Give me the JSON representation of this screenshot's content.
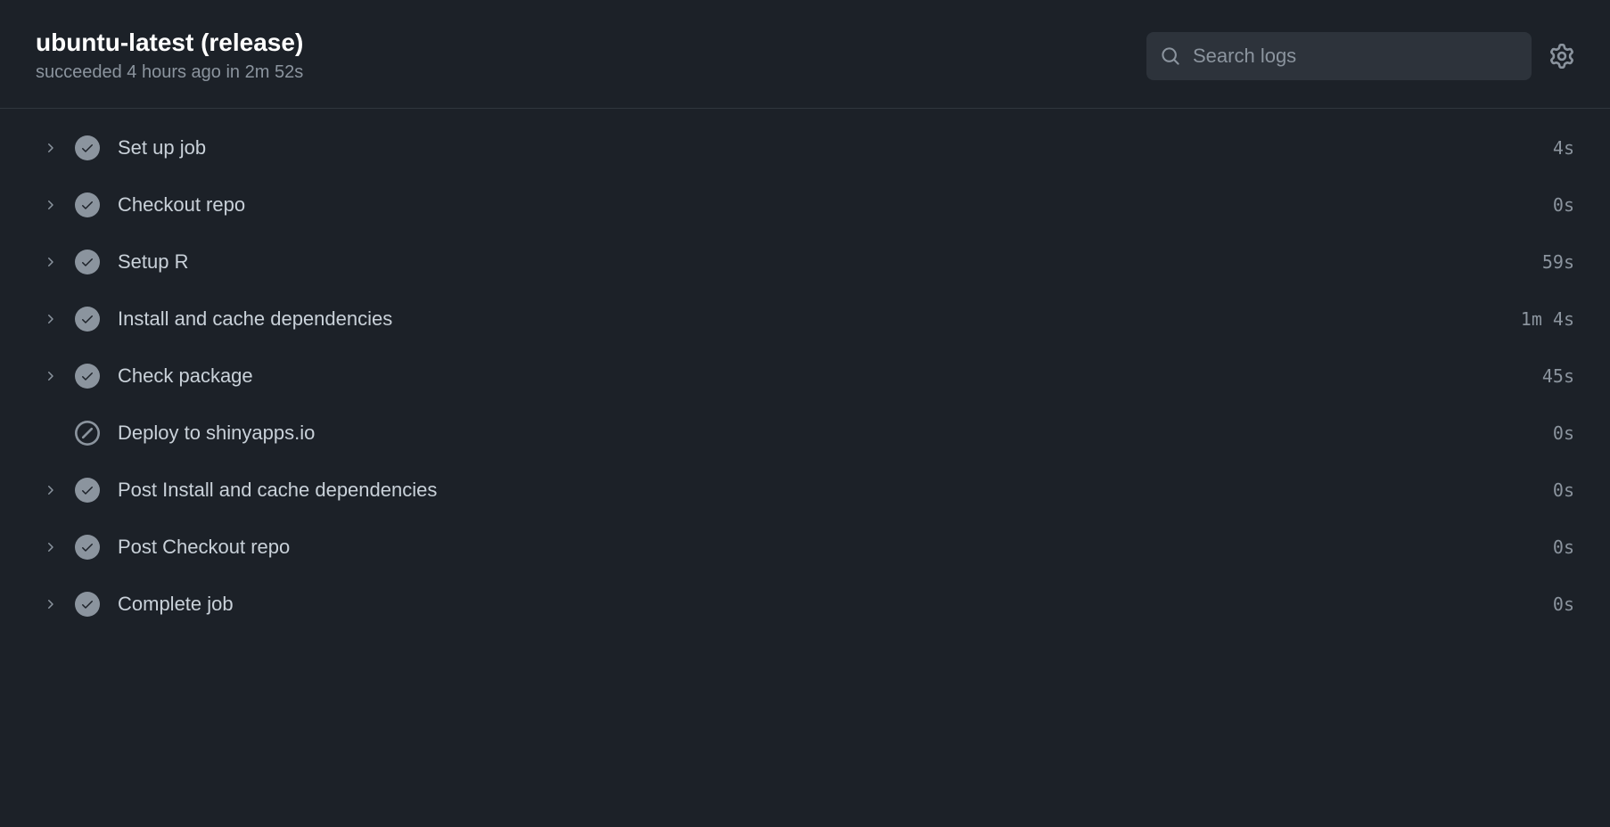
{
  "header": {
    "title": "ubuntu-latest (release)",
    "subtitle": "succeeded 4 hours ago in 2m 52s",
    "search_placeholder": "Search logs"
  },
  "steps": [
    {
      "name": "Set up job",
      "duration": "4s",
      "status": "success",
      "expandable": true
    },
    {
      "name": "Checkout repo",
      "duration": "0s",
      "status": "success",
      "expandable": true
    },
    {
      "name": "Setup R",
      "duration": "59s",
      "status": "success",
      "expandable": true
    },
    {
      "name": "Install and cache dependencies",
      "duration": "1m 4s",
      "status": "success",
      "expandable": true
    },
    {
      "name": "Check package",
      "duration": "45s",
      "status": "success",
      "expandable": true
    },
    {
      "name": "Deploy to shinyapps.io",
      "duration": "0s",
      "status": "skipped",
      "expandable": false
    },
    {
      "name": "Post Install and cache dependencies",
      "duration": "0s",
      "status": "success",
      "expandable": true
    },
    {
      "name": "Post Checkout repo",
      "duration": "0s",
      "status": "success",
      "expandable": true
    },
    {
      "name": "Complete job",
      "duration": "0s",
      "status": "success",
      "expandable": true
    }
  ]
}
